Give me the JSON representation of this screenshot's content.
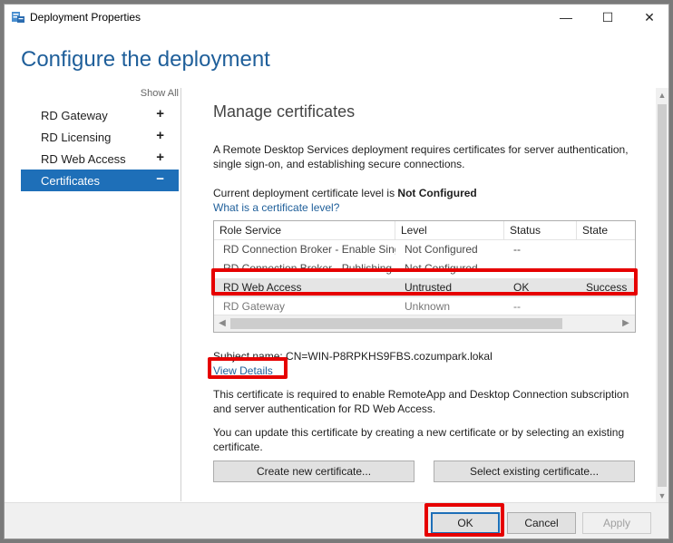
{
  "window": {
    "title": "Deployment Properties",
    "minimize_glyph": "—",
    "maximize_glyph": "☐",
    "close_glyph": "✕"
  },
  "header": {
    "title": "Configure the deployment"
  },
  "nav": {
    "show_all": "Show All",
    "items": [
      {
        "label": "RD Gateway",
        "sign": "+"
      },
      {
        "label": "RD Licensing",
        "sign": "+"
      },
      {
        "label": "RD Web Access",
        "sign": "+"
      },
      {
        "label": "Certificates",
        "sign": "−",
        "selected": true
      }
    ]
  },
  "content": {
    "section_title": "Manage certificates",
    "intro": "A Remote Desktop Services deployment requires certificates for server authentication, single sign-on, and establishing secure connections.",
    "level_prefix": "Current deployment certificate level is ",
    "level_value": "Not Configured",
    "level_link": "What is a certificate level?",
    "grid": {
      "headers": [
        "Role Service",
        "Level",
        "Status",
        "State"
      ],
      "rows": [
        [
          "RD Connection Broker - Enable Single Sign On",
          "Not Configured",
          "--",
          ""
        ],
        [
          "RD Connection Broker - Publishing",
          "Not Configured",
          "--",
          ""
        ],
        [
          "RD Web Access",
          "Untrusted",
          "OK",
          "Success"
        ],
        [
          "RD Gateway",
          "Unknown",
          "--",
          ""
        ]
      ]
    },
    "subject_name": "Subject name: CN=WIN-P8RPKHS9FBS.cozumpark.lokal",
    "view_details": "View Details",
    "required_text": "This certificate is required to enable RemoteApp and Desktop Connection subscription and server authentication for RD Web Access.",
    "update_text": "You can update this certificate by creating a new certificate or by selecting an existing certificate.",
    "create_button": "Create new certificate...",
    "select_button": "Select existing certificate..."
  },
  "footer": {
    "ok": "OK",
    "cancel": "Cancel",
    "apply": "Apply"
  },
  "colors": {
    "accent": "#1e6fb8",
    "header_title": "#1f5f9a",
    "highlight": "#e60000"
  }
}
